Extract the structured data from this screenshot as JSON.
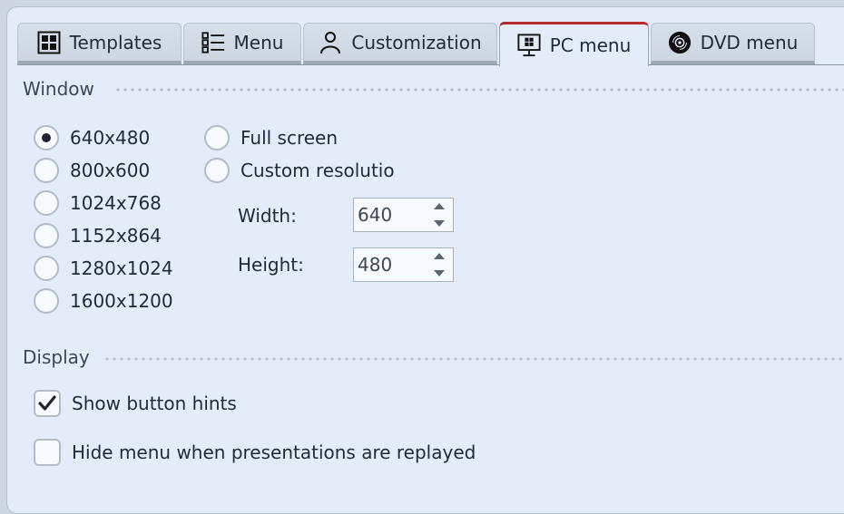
{
  "tabs": [
    {
      "label": "Templates",
      "icon": "grid-icon",
      "active": false
    },
    {
      "label": "Menu",
      "icon": "list-icon",
      "active": false
    },
    {
      "label": "Customization",
      "icon": "person-icon",
      "active": false
    },
    {
      "label": "PC menu",
      "icon": "monitor-windows-icon",
      "active": true
    },
    {
      "label": "DVD menu",
      "icon": "disc-icon",
      "active": false
    }
  ],
  "accent_color": "#b52a2a",
  "window_section": {
    "title": "Window",
    "resolutions": [
      {
        "label": "640x480",
        "selected": true
      },
      {
        "label": "800x600",
        "selected": false
      },
      {
        "label": "1024x768",
        "selected": false
      },
      {
        "label": "1152x864",
        "selected": false
      },
      {
        "label": "1280x1024",
        "selected": false
      },
      {
        "label": "1600x1200",
        "selected": false
      }
    ],
    "full_screen": {
      "label": "Full screen",
      "selected": false
    },
    "custom_resolution": {
      "label": "Custom resolutio",
      "selected": false
    },
    "width": {
      "label": "Width:",
      "value": "640"
    },
    "height": {
      "label": "Height:",
      "value": "480"
    }
  },
  "display_section": {
    "title": "Display",
    "show_button_hints": {
      "label": "Show button hints",
      "checked": true
    },
    "hide_menu": {
      "label": "Hide menu when presentations are replayed",
      "checked": false
    }
  }
}
